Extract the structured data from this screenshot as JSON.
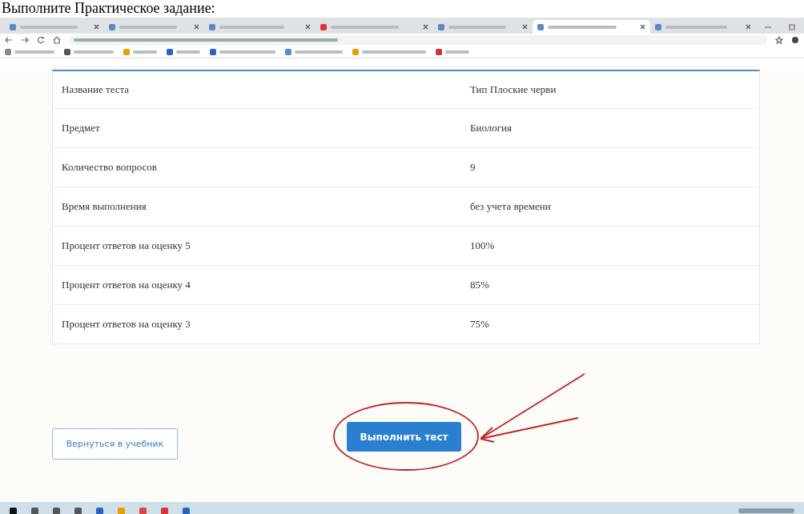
{
  "document_heading": "Выполните Практическое задание:",
  "browser_tabs": [
    {
      "selected": false
    },
    {
      "selected": false
    },
    {
      "selected": false
    },
    {
      "selected": false
    },
    {
      "selected": false
    },
    {
      "selected": true
    },
    {
      "selected": false
    }
  ],
  "table": {
    "rows": [
      {
        "label": "Название теста",
        "value": "Тип Плоские черви"
      },
      {
        "label": "Предмет",
        "value": "Биология"
      },
      {
        "label": "Количество вопросов",
        "value": "9"
      },
      {
        "label": "Время выполнения",
        "value": "без учета времени"
      },
      {
        "label": "Процент ответов на оценку 5",
        "value": "100%"
      },
      {
        "label": "Процент ответов на оценку 4",
        "value": "85%"
      },
      {
        "label": "Процент ответов на оценку 3",
        "value": "75%"
      }
    ]
  },
  "start_button": "Выполнить тест",
  "back_button": "Вернуться в учебник"
}
